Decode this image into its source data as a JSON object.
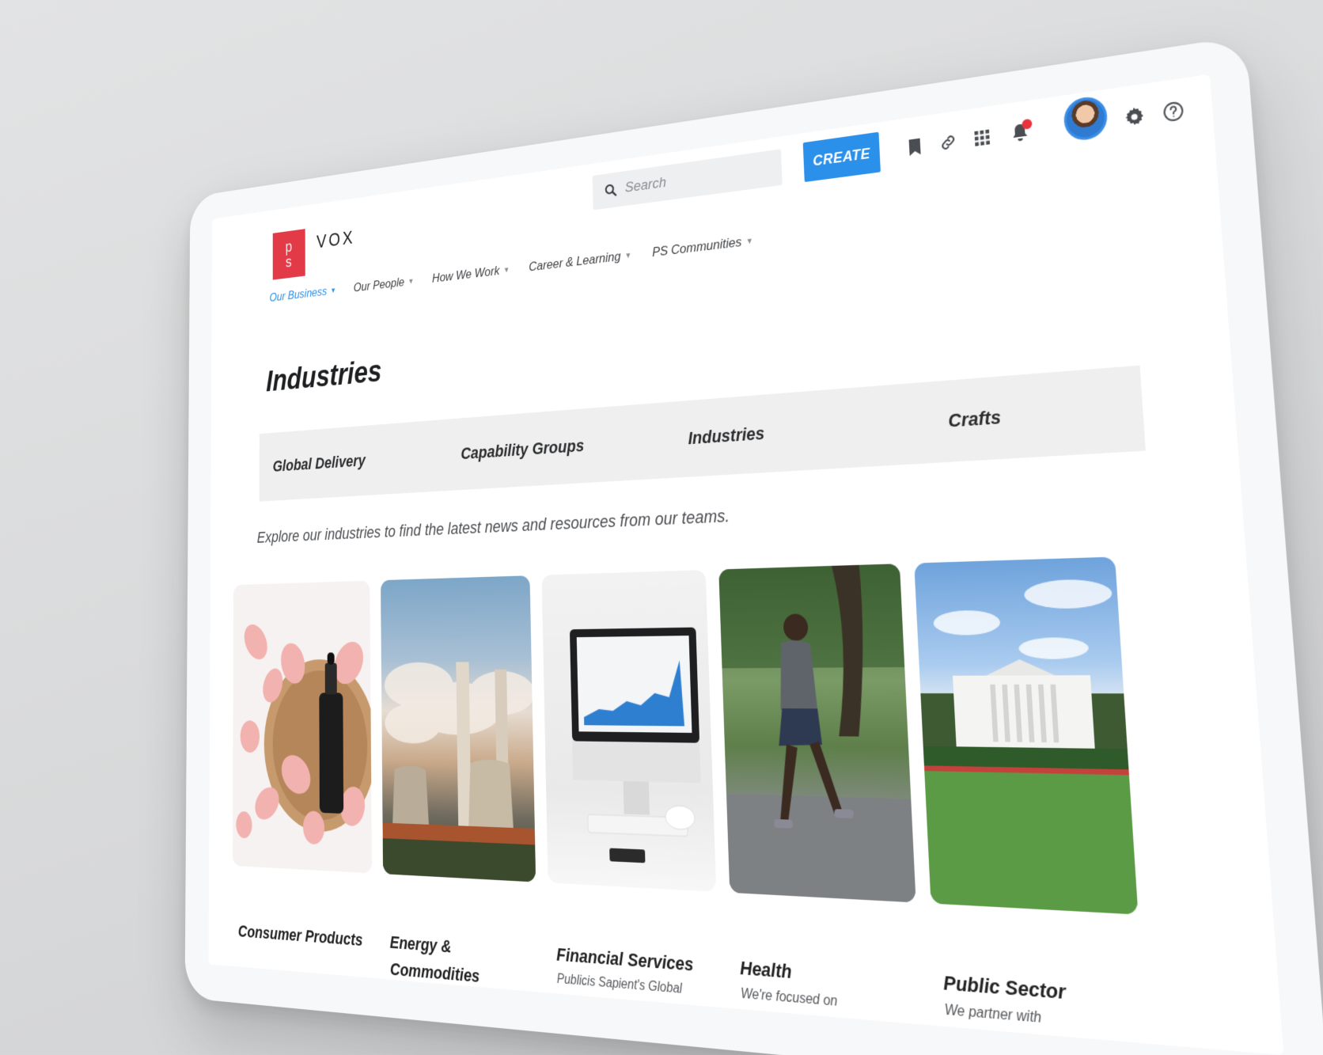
{
  "app": {
    "logo_letters": [
      "p",
      "s"
    ],
    "brand_name": "VOX",
    "accent_color": "#2a90ea",
    "brand_color": "#e23a47"
  },
  "search": {
    "placeholder": "Search"
  },
  "toolbar": {
    "create_label": "CREATE",
    "icons": [
      "bookmark-icon",
      "link-icon",
      "apps-grid-icon",
      "notification-bell-icon",
      "avatar",
      "settings-gear-icon",
      "help-icon"
    ]
  },
  "nav": {
    "items": [
      {
        "label": "Our Business",
        "active": true
      },
      {
        "label": "Our People"
      },
      {
        "label": "How We Work"
      },
      {
        "label": "Career & Learning"
      },
      {
        "label": "PS Communities"
      }
    ]
  },
  "page": {
    "title": "Industries",
    "intro": "Explore our industries to find the latest news and resources from our teams."
  },
  "tabs": [
    {
      "label": "Global Delivery"
    },
    {
      "label": "Capability Groups"
    },
    {
      "label": "Industries",
      "active": true
    },
    {
      "label": "Crafts"
    }
  ],
  "cards": [
    {
      "title": "Consumer Products",
      "description": ""
    },
    {
      "title": "Energy & Commodities",
      "description": ""
    },
    {
      "title": "Financial Services",
      "description": "Publicis Sapient's Global"
    },
    {
      "title": "Health",
      "description": "We're focused on"
    },
    {
      "title": "Public Sector",
      "description": "We partner with"
    }
  ]
}
